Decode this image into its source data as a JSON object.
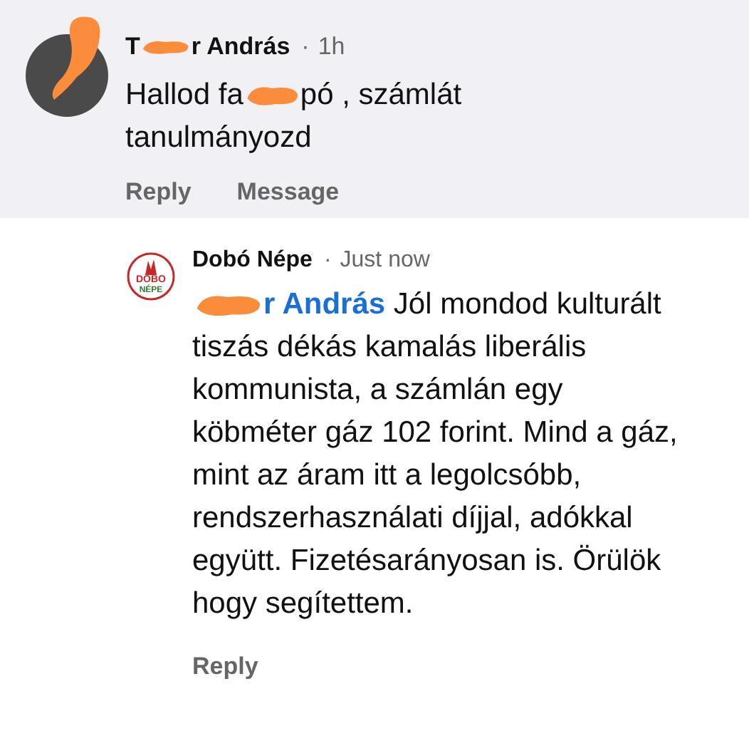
{
  "comments": [
    {
      "author_start": "T",
      "author_end": "r András",
      "separator": "·",
      "time": "1h",
      "body_start": "Hallod fa",
      "body_end": "pó , számlát",
      "body_line2": "tanulmányozd",
      "actions": [
        "Reply",
        "Message"
      ]
    }
  ],
  "reply": {
    "logo_top": "DOBO",
    "logo_bottom": "NÉPE",
    "author": "Dobó Népe",
    "separator": "·",
    "time": "Just now",
    "mention": "r András",
    "body": "Jól mondod kulturált tiszás dékás kamalás liberális kommunista, a számlán egy köbméter gáz 102 forint. Mind a gáz, mint az áram itt a legolcsóbb, rendszerhasználati díjjal, adókkal együtt. Fizetésarányosan is. Örülök hogy segítettem.",
    "actions": [
      "Reply"
    ]
  }
}
